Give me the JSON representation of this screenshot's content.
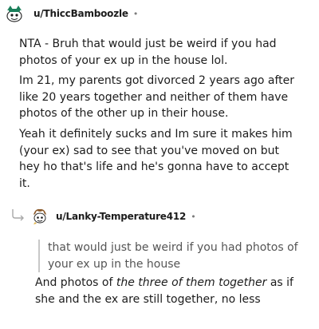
{
  "comments": [
    {
      "username": "u/ThiccBamboozle",
      "separator": "•",
      "avatar_icon": "snoo-avatar-icon",
      "paragraphs": [
        "NTA - Bruh that would just be weird if you had photos of your ex up in the house lol.",
        "Im 21, my parents got divorced 2 years ago after like 20 years together and neither of them have photos of the other up in their house.",
        "Yeah it definitely sucks and Im sure it makes him (your ex) sad to see that you've moved on but hey ho that's life and he's gonna have to accept it."
      ]
    },
    {
      "username": "u/Lanky-Temperature412",
      "separator": "•",
      "avatar_icon": "snoo-avatar-icon",
      "reply_icon": "reply-arrow-icon",
      "quote": "that would just be weird if you had photos of your ex up in the house",
      "reply": {
        "before": "And photos of ",
        "emphasis": "the three of them together",
        "after": " as if she and the ex are still together, no less"
      }
    }
  ],
  "colors": {
    "text": "#1c1c1c",
    "muted": "#7c7c7c",
    "quote_bar": "#c8c8c8",
    "quote_text": "#555555"
  }
}
